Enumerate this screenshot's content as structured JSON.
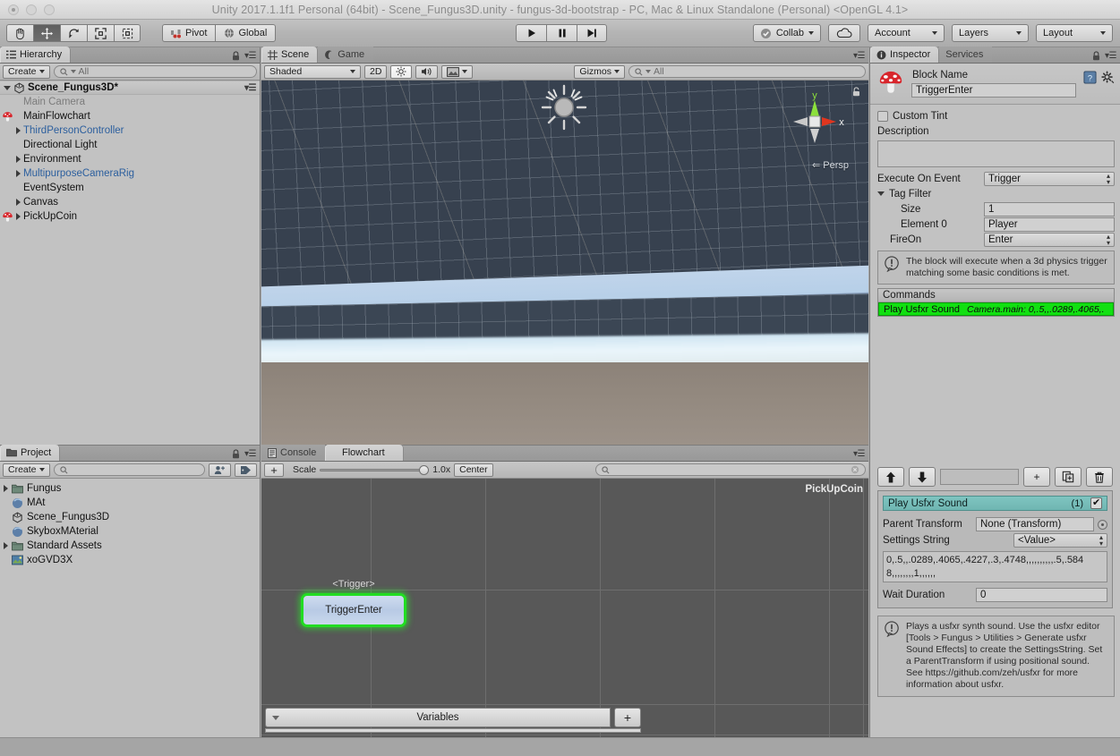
{
  "window": {
    "title": "Unity 2017.1.1f1 Personal (64bit) - Scene_Fungus3D.unity - fungus-3d-bootstrap - PC, Mac & Linux Standalone (Personal) <OpenGL 4.1>"
  },
  "toolbar": {
    "tools": [
      {
        "name": "hand-tool",
        "icon": "hand-icon",
        "active": false
      },
      {
        "name": "move-tool",
        "icon": "move-icon",
        "active": true
      },
      {
        "name": "rotate-tool",
        "icon": "rotate-icon",
        "active": false
      },
      {
        "name": "scale-tool",
        "icon": "scale-icon",
        "active": false
      },
      {
        "name": "rect-tool",
        "icon": "rect-icon",
        "active": false
      }
    ],
    "pivot_label": "Pivot",
    "global_label": "Global",
    "play_label": "Play",
    "pause_label": "Pause",
    "step_label": "Step",
    "collab_label": "Collab",
    "cloud_label": "",
    "account_label": "Account",
    "layers_label": "Layers",
    "layout_label": "Layout"
  },
  "hierarchy": {
    "tab_label": "Hierarchy",
    "create_label": "Create",
    "search_placeholder": "All",
    "scene_name": "Scene_Fungus3D*",
    "items": [
      {
        "label": "Main Camera",
        "indent": 1,
        "arrow": false,
        "icon": "none",
        "style": "dim"
      },
      {
        "label": "MainFlowchart",
        "indent": 1,
        "arrow": false,
        "icon": "mushroom",
        "style": "normal"
      },
      {
        "label": "ThirdPersonController",
        "indent": 1,
        "arrow": true,
        "icon": "none",
        "style": "prefab"
      },
      {
        "label": "Directional Light",
        "indent": 1,
        "arrow": false,
        "icon": "none",
        "style": "normal"
      },
      {
        "label": "Environment",
        "indent": 1,
        "arrow": true,
        "icon": "none",
        "style": "normal"
      },
      {
        "label": "MultipurposeCameraRig",
        "indent": 1,
        "arrow": true,
        "icon": "none",
        "style": "prefab"
      },
      {
        "label": "EventSystem",
        "indent": 1,
        "arrow": false,
        "icon": "none",
        "style": "normal"
      },
      {
        "label": "Canvas",
        "indent": 1,
        "arrow": true,
        "icon": "none",
        "style": "normal"
      },
      {
        "label": "PickUpCoin",
        "indent": 1,
        "arrow": true,
        "icon": "mushroom",
        "style": "normal"
      }
    ]
  },
  "scene": {
    "tab_scene": "Scene",
    "tab_game": "Game",
    "shading_mode": "Shaded",
    "twod_label": "2D",
    "gizmos_label": "Gizmos",
    "search_placeholder": "All",
    "axis_y": "y",
    "axis_x": "x",
    "projection": "Persp"
  },
  "project": {
    "tab_label": "Project",
    "create_label": "Create",
    "search_placeholder": "",
    "items": [
      {
        "label": "Fungus",
        "arrow": true,
        "icon": "folder"
      },
      {
        "label": "MAt",
        "arrow": false,
        "icon": "material"
      },
      {
        "label": "Scene_Fungus3D",
        "arrow": false,
        "icon": "unity"
      },
      {
        "label": "SkyboxMAterial",
        "arrow": false,
        "icon": "material"
      },
      {
        "label": "Standard Assets",
        "arrow": true,
        "icon": "folder"
      },
      {
        "label": "xoGVD3X",
        "arrow": false,
        "icon": "texture"
      }
    ]
  },
  "flowchart": {
    "tab_console": "Console",
    "tab_flowchart": "Flowchart",
    "add_label": "+",
    "scale_label": "Scale",
    "scale_value": "1.0x",
    "center_label": "Center",
    "search_placeholder": "",
    "chart_name": "PickUpCoin",
    "block": {
      "event_label": "<Trigger>",
      "name": "TriggerEnter"
    },
    "variables_label": "Variables",
    "variables_add": "+"
  },
  "inspector": {
    "tab_inspector": "Inspector",
    "tab_services": "Services",
    "block_name_label": "Block Name",
    "block_name_value": "TriggerEnter",
    "custom_tint_label": "Custom Tint",
    "custom_tint_checked": false,
    "description_label": "Description",
    "description_value": "",
    "execute_on_event_label": "Execute On Event",
    "execute_on_event_value": "Trigger",
    "tag_filter_label": "Tag Filter",
    "size_label": "Size",
    "size_value": "1",
    "element0_label": "Element 0",
    "element0_value": "Player",
    "fire_on_label": "FireOn",
    "fire_on_value": "Enter",
    "help_text": "The block will execute when a 3d physics trigger matching some basic conditions is met.",
    "commands_label": "Commands",
    "command_row": {
      "name": "Play Usfxr Sound",
      "summary": "Camera.main: 0,.5,,.0289,.4065,."
    }
  },
  "command_editor": {
    "up_label": "↑",
    "down_label": "↓",
    "add_label": "+",
    "duplicate_label": "duplicate-icon",
    "delete_label": "delete-icon",
    "title": "Play Usfxr Sound",
    "count": "(1)",
    "enabled": true,
    "parent_transform_label": "Parent Transform",
    "parent_transform_value": "None (Transform)",
    "settings_string_label": "Settings String",
    "settings_string_dropdown": "<Value>",
    "settings_string_value": "0,.5,,.0289,.4065,.4227,.3,.4748,,,,,,,,,,.5,.5848,,,,,,,,1,,,,,,",
    "wait_duration_label": "Wait Duration",
    "wait_duration_value": "0",
    "help_text": "Plays a usfxr synth sound. Use the usfxr editor [Tools > Fungus > Utilities > Generate usfxr Sound Effects] to create the SettingsString. Set a ParentTransform if using positional sound. See https://github.com/zeh/usfxr for more information about usfxr."
  },
  "colors": {
    "accent_green": "#11e011",
    "block_border": "#22dd22",
    "command_title": "#7fc4c0",
    "prefab_blue": "#2c5f9e"
  }
}
